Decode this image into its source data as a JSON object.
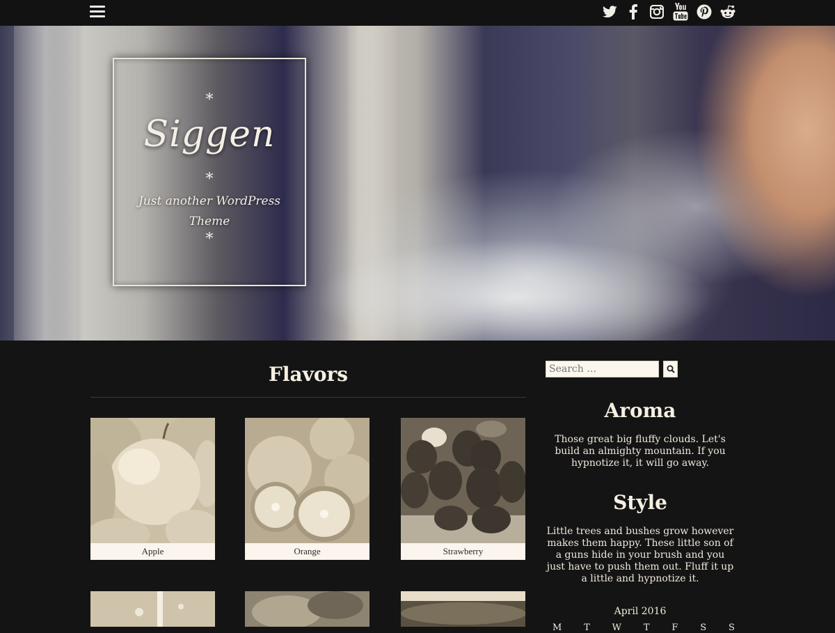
{
  "topbar": {
    "menu_icon": "hamburger-menu-icon",
    "social": [
      {
        "name": "twitter",
        "icon": "twitter-icon"
      },
      {
        "name": "facebook",
        "icon": "facebook-icon"
      },
      {
        "name": "instagram",
        "icon": "instagram-icon"
      },
      {
        "name": "youtube",
        "icon": "youtube-icon"
      },
      {
        "name": "pinterest",
        "icon": "pinterest-icon"
      },
      {
        "name": "reddit",
        "icon": "reddit-icon"
      }
    ]
  },
  "hero": {
    "ornament": "*",
    "site_title": "Siggen",
    "tagline": "Just another WordPress Theme"
  },
  "main": {
    "page_title": "Flavors",
    "items": [
      {
        "label": "Apple"
      },
      {
        "label": "Orange"
      },
      {
        "label": "Strawberry"
      }
    ]
  },
  "sidebar": {
    "search": {
      "placeholder": "Search …",
      "button_icon": "search-icon"
    },
    "widgets": [
      {
        "title": "Aroma",
        "text": "Those great big fluffy clouds. Let's build an almighty mountain. If you hypnotize it, it will go away."
      },
      {
        "title": "Style",
        "text": "Little trees and bushes grow however makes them happy. These little son of a guns hide in your brush and you just have to push them out. Fluff it up a little and hypnotize it."
      }
    ],
    "calendar": {
      "caption": "April 2016",
      "days": [
        "M",
        "T",
        "W",
        "T",
        "F",
        "S",
        "S"
      ]
    }
  },
  "colors": {
    "background": "#141414",
    "topbar": "#121212",
    "text_light": "#f3ead8",
    "caption_bg": "#fbf5ee"
  }
}
